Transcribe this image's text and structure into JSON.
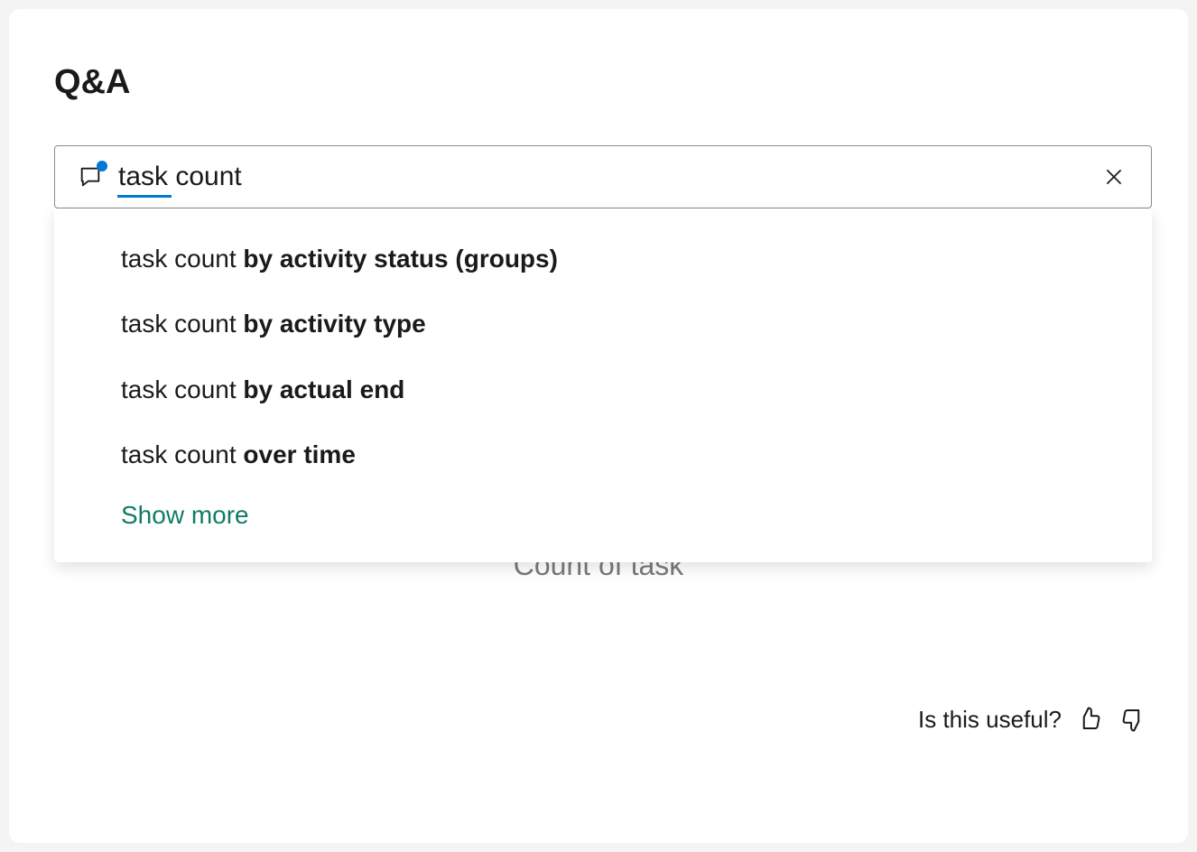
{
  "title": "Q&A",
  "search": {
    "value": "task count",
    "clear_label": "Clear"
  },
  "suggestions": [
    {
      "prefix": "task count ",
      "bold": "by activity status (groups)"
    },
    {
      "prefix": "task count ",
      "bold": "by activity type"
    },
    {
      "prefix": "task count ",
      "bold": "by actual end"
    },
    {
      "prefix": "task count ",
      "bold": "over time"
    }
  ],
  "show_more": "Show more",
  "result_title": "Count of task",
  "feedback": {
    "prompt": "Is this useful?"
  }
}
